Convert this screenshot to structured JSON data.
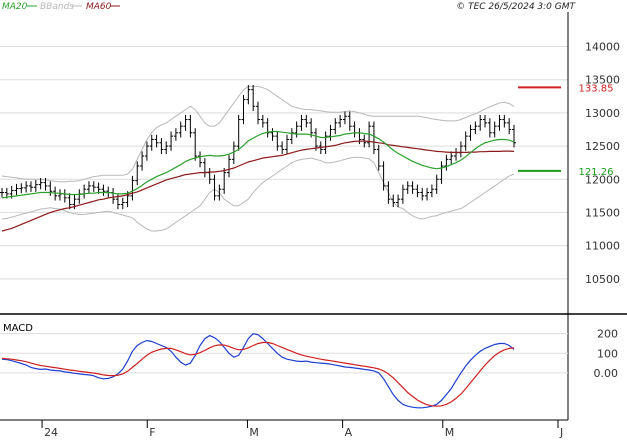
{
  "header": {
    "legend": [
      {
        "name": "MA20",
        "color": "#2ca02c"
      },
      {
        "name": "BBands",
        "color": "#b8b8b8"
      },
      {
        "name": "MA60",
        "color": "#8b1a1a"
      }
    ],
    "copyright": "© TEC 26/5/2024 3:0 GMT"
  },
  "colors": {
    "price": "#000000",
    "ma20": "#2ca02c",
    "ma60": "#8b1a1a",
    "bbands": "#b8b8b8",
    "grid": "#dddddd",
    "macd": "#1f3fd0",
    "signal": "#d01f1f",
    "resistance": "#d01f1f",
    "support": "#1aa01a"
  },
  "chart_data": [
    {
      "type": "line",
      "panel": "price",
      "ylim": [
        10000,
        14400
      ],
      "yticks": [
        10500,
        11000,
        11500,
        12000,
        12500,
        13000,
        13500,
        14000
      ],
      "xlim": [
        0,
        113
      ],
      "xticks": [
        {
          "label": "24",
          "x": 8
        },
        {
          "label": "F",
          "x": 29
        },
        {
          "label": "M",
          "x": 49
        },
        {
          "label": "A",
          "x": 68
        },
        {
          "label": "M",
          "x": 88
        },
        {
          "label": "J",
          "x": 111
        }
      ],
      "series": [
        {
          "name": "",
          "role": "price",
          "values": [
            11800,
            11780,
            11830,
            11860,
            11870,
            11900,
            11880,
            11920,
            11950,
            11900,
            11820,
            11750,
            11780,
            11720,
            11620,
            11700,
            11780,
            11850,
            11900,
            11880,
            11850,
            11820,
            11800,
            11700,
            11620,
            11650,
            11750,
            11980,
            12200,
            12350,
            12500,
            12600,
            12550,
            12450,
            12500,
            12650,
            12700,
            12800,
            12900,
            12700,
            12350,
            12250,
            12100,
            12000,
            11750,
            11850,
            12100,
            12300,
            12500,
            12900,
            13200,
            13350,
            13100,
            12900,
            12850,
            12700,
            12650,
            12500,
            12450,
            12600,
            12700,
            12800,
            12900,
            12850,
            12700,
            12500,
            12450,
            12650,
            12750,
            12850,
            12900,
            12950,
            12800,
            12700,
            12600,
            12550,
            12800,
            12450,
            12200,
            11900,
            11700,
            11650,
            11700,
            11850,
            11900,
            11850,
            11800,
            11750,
            11800,
            11850,
            12000,
            12200,
            12300,
            12350,
            12400,
            12500,
            12650,
            12750,
            12800,
            12900,
            12850,
            12700,
            12800,
            12900,
            12850,
            12750,
            12550
          ]
        },
        {
          "name": "MA20",
          "role": "ma20",
          "values": [
            11720,
            11730,
            11740,
            11750,
            11760,
            11770,
            11780,
            11790,
            11800,
            11800,
            11800,
            11790,
            11790,
            11780,
            11770,
            11770,
            11770,
            11780,
            11790,
            11790,
            11800,
            11800,
            11800,
            11790,
            11780,
            11780,
            11790,
            11820,
            11860,
            11910,
            11960,
            12000,
            12040,
            12070,
            12100,
            12140,
            12180,
            12220,
            12270,
            12300,
            12320,
            12340,
            12350,
            12360,
            12350,
            12350,
            12360,
            12380,
            12410,
            12450,
            12510,
            12580,
            12620,
            12660,
            12690,
            12710,
            12720,
            12720,
            12710,
            12700,
            12690,
            12680,
            12680,
            12680,
            12670,
            12650,
            12630,
            12630,
            12640,
            12650,
            12660,
            12680,
            12690,
            12700,
            12700,
            12690,
            12680,
            12650,
            12610,
            12560,
            12500,
            12440,
            12390,
            12350,
            12310,
            12270,
            12240,
            12210,
            12190,
            12170,
            12160,
            12170,
            12190,
            12220,
            12250,
            12290,
            12340,
            12400,
            12460,
            12510,
            12550,
            12570,
            12590,
            12600,
            12600,
            12590,
            12560
          ]
        },
        {
          "name": "MA60",
          "role": "ma60",
          "values": [
            11220,
            11240,
            11260,
            11290,
            11320,
            11350,
            11380,
            11410,
            11440,
            11470,
            11500,
            11520,
            11540,
            11560,
            11570,
            11590,
            11610,
            11630,
            11650,
            11670,
            11690,
            11700,
            11720,
            11730,
            11740,
            11750,
            11770,
            11790,
            11810,
            11840,
            11870,
            11900,
            11930,
            11960,
            11990,
            12010,
            12030,
            12050,
            12070,
            12080,
            12090,
            12100,
            12100,
            12110,
            12110,
            12120,
            12130,
            12150,
            12170,
            12200,
            12230,
            12260,
            12280,
            12300,
            12320,
            12330,
            12340,
            12350,
            12360,
            12380,
            12400,
            12420,
            12440,
            12450,
            12460,
            12470,
            12480,
            12490,
            12500,
            12510,
            12530,
            12550,
            12560,
            12570,
            12575,
            12575,
            12570,
            12560,
            12550,
            12540,
            12520,
            12510,
            12500,
            12490,
            12480,
            12470,
            12460,
            12450,
            12440,
            12430,
            12420,
            12415,
            12410,
            12405,
            12405,
            12405,
            12405,
            12410,
            12410,
            12415,
            12415,
            12420,
            12420,
            12420,
            12425,
            12425,
            12420
          ]
        },
        {
          "name": "BBands",
          "role": "bb_upper",
          "values": [
            12050,
            12040,
            12030,
            12020,
            12010,
            12000,
            12000,
            12000,
            12000,
            11990,
            11980,
            11970,
            11960,
            11960,
            11970,
            11970,
            11980,
            12000,
            12020,
            12040,
            12050,
            12060,
            12060,
            12060,
            12060,
            12060,
            12080,
            12150,
            12300,
            12450,
            12600,
            12700,
            12780,
            12820,
            12850,
            12900,
            12950,
            13000,
            13050,
            13100,
            13050,
            12950,
            12850,
            12800,
            12800,
            12850,
            12950,
            13050,
            13150,
            13250,
            13350,
            13400,
            13400,
            13400,
            13380,
            13350,
            13300,
            13250,
            13200,
            13150,
            13100,
            13080,
            13060,
            13050,
            13050,
            13040,
            13030,
            13020,
            13010,
            13010,
            13010,
            13020,
            13030,
            13020,
            13000,
            12980,
            12960,
            12950,
            12950,
            12950,
            12950,
            12950,
            12950,
            12950,
            12950,
            12950,
            12950,
            12940,
            12930,
            12910,
            12900,
            12890,
            12880,
            12880,
            12880,
            12900,
            12930,
            12960,
            12990,
            13020,
            13060,
            13090,
            13120,
            13150,
            13160,
            13140,
            13100
          ]
        },
        {
          "name": "BBands",
          "role": "bb_lower",
          "values": [
            11400,
            11410,
            11430,
            11450,
            11470,
            11490,
            11510,
            11530,
            11550,
            11560,
            11570,
            11560,
            11550,
            11530,
            11500,
            11480,
            11470,
            11470,
            11480,
            11490,
            11500,
            11510,
            11520,
            11500,
            11480,
            11460,
            11440,
            11420,
            11350,
            11300,
            11250,
            11220,
            11220,
            11230,
            11250,
            11300,
            11350,
            11400,
            11450,
            11500,
            11550,
            11600,
            11700,
            11800,
            11850,
            11800,
            11700,
            11650,
            11600,
            11600,
            11650,
            11700,
            11800,
            11880,
            11950,
            12000,
            12050,
            12100,
            12150,
            12200,
            12250,
            12280,
            12300,
            12310,
            12320,
            12300,
            12280,
            12250,
            12250,
            12260,
            12280,
            12300,
            12320,
            12330,
            12330,
            12320,
            12310,
            12250,
            12100,
            11950,
            11800,
            11650,
            11580,
            11560,
            11500,
            11450,
            11420,
            11400,
            11420,
            11440,
            11450,
            11480,
            11500,
            11520,
            11540,
            11560,
            11600,
            11650,
            11700,
            11750,
            11800,
            11850,
            11900,
            11950,
            12000,
            12050,
            12080
          ]
        }
      ],
      "annotations": [
        {
          "label": "133.85",
          "value": 13385,
          "role": "resistance"
        },
        {
          "label": "121.26",
          "value": 12126,
          "role": "support"
        }
      ]
    },
    {
      "type": "line",
      "panel": "macd",
      "title": "MACD",
      "ylim": [
        -230,
        280
      ],
      "yticks": [
        {
          "label": "0.00",
          "value": 0
        },
        {
          "label": "100",
          "value": 100
        },
        {
          "label": "200",
          "value": 200
        }
      ],
      "series": [
        {
          "name": "",
          "role": "macd",
          "values": [
            70,
            68,
            62,
            55,
            48,
            40,
            28,
            22,
            18,
            20,
            15,
            12,
            10,
            5,
            2,
            -2,
            -5,
            -8,
            -10,
            -15,
            -25,
            -30,
            -28,
            -20,
            -5,
            20,
            60,
            110,
            140,
            155,
            165,
            160,
            150,
            140,
            130,
            110,
            80,
            55,
            40,
            50,
            90,
            140,
            175,
            190,
            180,
            160,
            130,
            100,
            80,
            90,
            130,
            175,
            200,
            195,
            175,
            150,
            125,
            100,
            80,
            70,
            65,
            60,
            58,
            60,
            55,
            52,
            50,
            48,
            45,
            40,
            35,
            30,
            28,
            25,
            22,
            18,
            15,
            10,
            0,
            -30,
            -70,
            -110,
            -140,
            -160,
            -170,
            -175,
            -178,
            -178,
            -175,
            -170,
            -160,
            -140,
            -110,
            -80,
            -40,
            0,
            35,
            65,
            90,
            110,
            125,
            135,
            145,
            150,
            150,
            140,
            120
          ]
        },
        {
          "name": "",
          "role": "signal",
          "values": [
            75,
            72,
            70,
            66,
            62,
            57,
            50,
            44,
            38,
            34,
            30,
            27,
            23,
            19,
            15,
            12,
            8,
            5,
            2,
            -1,
            -5,
            -10,
            -13,
            -14,
            -12,
            -5,
            8,
            28,
            48,
            70,
            90,
            105,
            115,
            122,
            125,
            125,
            118,
            108,
            98,
            92,
            95,
            103,
            115,
            128,
            138,
            143,
            142,
            135,
            125,
            118,
            120,
            128,
            140,
            150,
            155,
            155,
            150,
            140,
            130,
            120,
            110,
            100,
            92,
            85,
            80,
            75,
            70,
            66,
            62,
            58,
            54,
            50,
            46,
            42,
            38,
            34,
            30,
            26,
            20,
            10,
            -5,
            -25,
            -50,
            -75,
            -100,
            -120,
            -138,
            -152,
            -162,
            -168,
            -170,
            -168,
            -160,
            -148,
            -130,
            -108,
            -80,
            -50,
            -20,
            10,
            40,
            65,
            88,
            105,
            118,
            125,
            128
          ]
        }
      ]
    }
  ]
}
